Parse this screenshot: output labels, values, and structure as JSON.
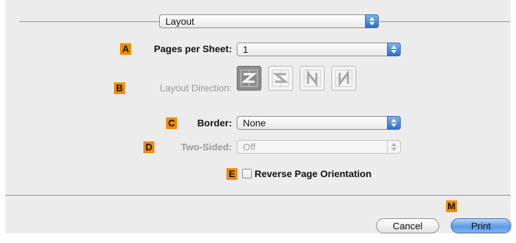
{
  "window": {
    "panel_selector": "Layout",
    "accent_color": "#2a6fd1",
    "badge_color": "#f08c00"
  },
  "rows": {
    "pages_per_sheet": {
      "badge": "A",
      "label": "Pages per Sheet:",
      "value": "1"
    },
    "layout_direction": {
      "badge": "B",
      "label": "Layout Direction:",
      "options": [
        "z-icon",
        "reverse-z-icon",
        "n-icon",
        "reverse-n-icon"
      ],
      "selected": "z-icon"
    },
    "border": {
      "badge": "C",
      "label": "Border:",
      "value": "None"
    },
    "two_sided": {
      "badge": "D",
      "label": "Two-Sided:",
      "value": "Off",
      "enabled": false
    },
    "reverse_orientation": {
      "badge": "E",
      "label": "Reverse Page Orientation",
      "checked": false
    }
  },
  "footer": {
    "badge": "M",
    "cancel_label": "Cancel",
    "print_label": "Print"
  }
}
